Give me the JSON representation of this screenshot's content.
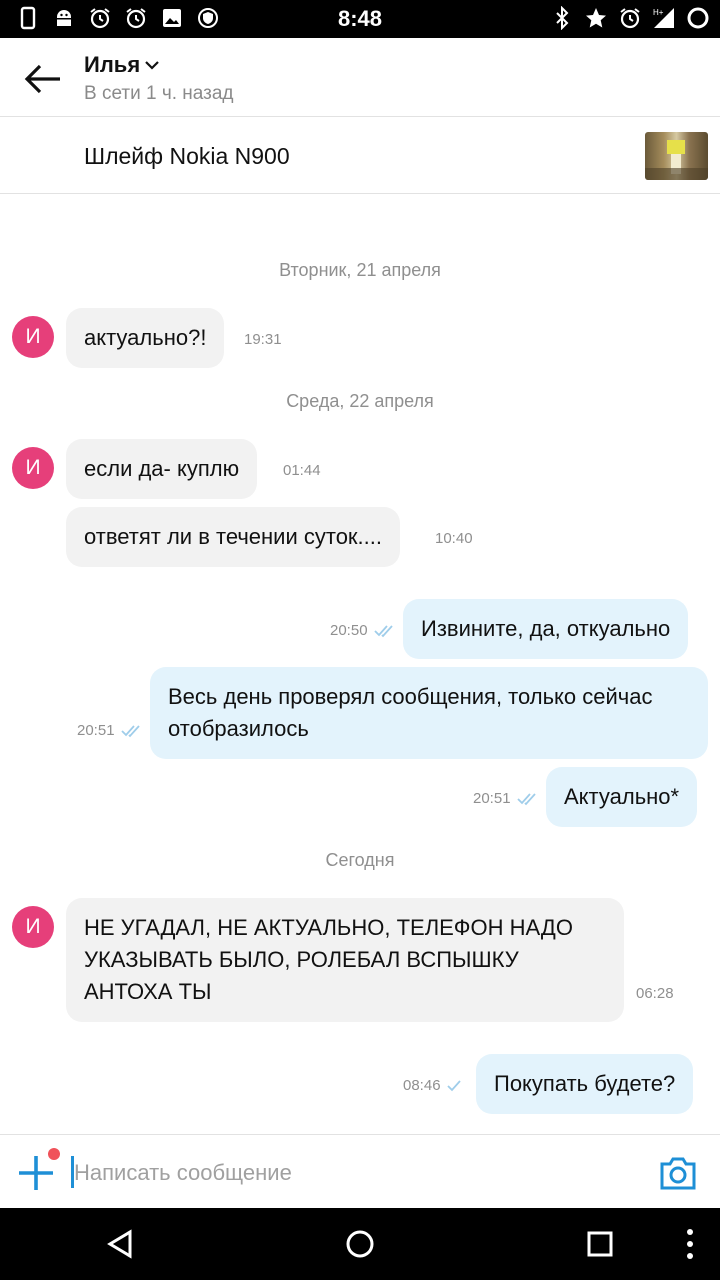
{
  "status_bar": {
    "time": "8:48",
    "left_icons": [
      "phone-icon",
      "android-icon",
      "alarm-icon",
      "alarm-icon",
      "image-icon",
      "shield-icon"
    ],
    "right_icons": [
      "bluetooth-icon",
      "star-icon",
      "alarm-icon",
      "signal-icon",
      "battery-icon"
    ],
    "network": "H+"
  },
  "header": {
    "name": "Илья",
    "status": "В сети 1 ч. назад"
  },
  "ad": {
    "title": "Шлейф Nokia N900"
  },
  "avatar_letter": "И",
  "dates": {
    "d1": "Вторник, 21 апреля",
    "d2": "Среда, 22 апреля",
    "d3": "Сегодня"
  },
  "messages": [
    {
      "dir": "in",
      "text": "актуально?!",
      "time": "19:31"
    },
    {
      "dir": "in",
      "text": "если да- куплю",
      "time": "01:44"
    },
    {
      "dir": "in",
      "text": "ответят ли в течении суток....",
      "time": "10:40"
    },
    {
      "dir": "out",
      "text": "Извините, да, откуально",
      "time": "20:50"
    },
    {
      "dir": "out",
      "text": "Весь день проверял сообщения, только сейчас отобразилось",
      "time": "20:51"
    },
    {
      "dir": "out",
      "text": "Актуально*",
      "time": "20:51"
    },
    {
      "dir": "in",
      "text": "НЕ УГАДАЛ, НЕ АКТУАЛЬНО, ТЕЛЕФОН НАДО УКАЗЫВАТЬ БЫЛО, РОЛЕБАЛ ВСПЫШКУ АНТОХА ТЫ",
      "time": "06:28"
    },
    {
      "dir": "out",
      "text": "Покупать будете?",
      "time": "08:46"
    }
  ],
  "input": {
    "placeholder": "Написать сообщение"
  },
  "colors": {
    "accent": "#1e8fd6",
    "avatar": "#e63f7a",
    "incoming_bubble": "#f2f2f2",
    "outgoing_bubble": "#e3f3fc",
    "notification_dot": "#f0525a"
  }
}
